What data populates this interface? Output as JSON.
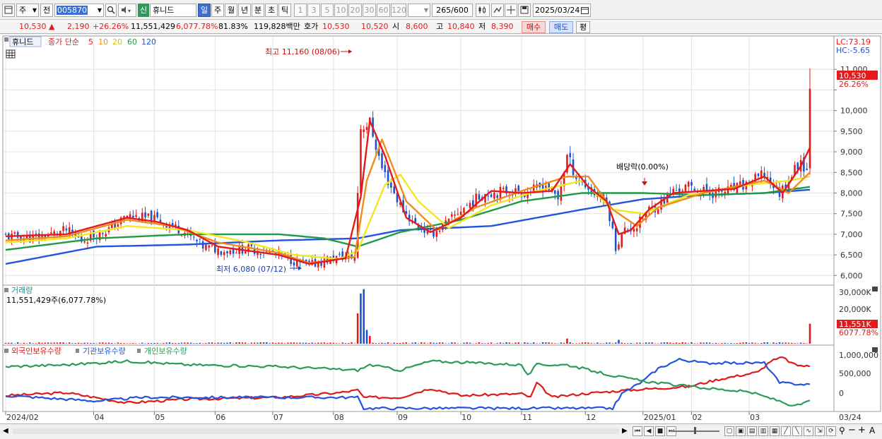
{
  "toolbar": {
    "market_type": "주",
    "prev_label": "전",
    "stock_code": "005870",
    "new_badge": "신",
    "stock_name": "휴니드",
    "periods": [
      "일",
      "주",
      "월",
      "년",
      "분",
      "초",
      "틱"
    ],
    "active_period": "일",
    "intervals": [
      "1",
      "3",
      "5",
      "10",
      "20",
      "30",
      "60",
      "120"
    ],
    "count": "265",
    "count_total": "/600",
    "date": "2025/03/24"
  },
  "quote": {
    "price": "10,530",
    "change": "2,190",
    "change_pct": "+26.26%",
    "volume": "11,551,429",
    "volume_pct": "6,077.78%",
    "turnover": "81.83%",
    "amount": "119,828백만",
    "hoga_label": "호가",
    "ask": "10,530",
    "bid": "10,520",
    "open_label": "시",
    "open": "8,600",
    "high_label": "고",
    "high": "10,840",
    "low_label": "저",
    "low": "8,390",
    "buy_label": "매수",
    "sell_label": "매도",
    "eval_label": "평"
  },
  "colors": {
    "up": "#e31b1b",
    "down": "#1e52c8",
    "ma5": "#e31b1b",
    "ma10": "#f08c1e",
    "ma20": "#f5e61e",
    "ma60": "#229944",
    "ma120": "#2255dd",
    "foreign": "#e01a1a",
    "institution": "#2255dd",
    "individual": "#2b9a5a",
    "price_badge": "#e31b1b",
    "toolbar_selected": "#3b6fd1"
  },
  "chart_data": [
    {
      "type": "candlestick",
      "title": "휴니드",
      "legend": {
        "prefix": "종가 단순",
        "items": [
          {
            "name": "5",
            "color": "#e31b1b"
          },
          {
            "name": "10",
            "color": "#f08c1e"
          },
          {
            "name": "20",
            "color": "#d8c400"
          },
          {
            "name": "60",
            "color": "#229944"
          },
          {
            "name": "120",
            "color": "#2255dd"
          }
        ]
      },
      "ylim": [
        5800,
        11500
      ],
      "y_ticks": [
        6000,
        6500,
        7000,
        7500,
        8000,
        8500,
        9000,
        9500,
        10000,
        10500,
        11000
      ],
      "y_tick_labels": [
        "6,000",
        "6,500",
        "7,000",
        "7,500",
        "8,000",
        "8,500",
        "9,000",
        "9,500",
        "10,000",
        "",
        "11,000"
      ],
      "lc_label": "LC:73.19",
      "hc_label": "HC:-5.65",
      "last_price_label": "10,530",
      "last_pct_label": "26.26%",
      "annotations": {
        "high": "최고 11,160 (08/06)",
        "low": "최저 6,080 (07/12)",
        "dividend": "배당락(0.00%)"
      },
      "x_tick_labels": [
        "2024/02",
        "04",
        "05",
        "06",
        "07",
        "08",
        "09",
        "10",
        "11",
        "12",
        "2025/01",
        "02",
        "03",
        "03/24"
      ],
      "anchors": [
        [
          0,
          6950
        ],
        [
          10,
          6900
        ],
        [
          20,
          7100
        ],
        [
          25,
          6850
        ],
        [
          35,
          7150
        ],
        [
          40,
          7450
        ],
        [
          50,
          7350
        ],
        [
          58,
          7100
        ],
        [
          65,
          6700
        ],
        [
          72,
          6600
        ],
        [
          80,
          6650
        ],
        [
          88,
          6550
        ],
        [
          95,
          6350
        ],
        [
          100,
          6250
        ],
        [
          110,
          6450
        ],
        [
          115,
          6450
        ],
        [
          117,
          9600
        ],
        [
          120,
          9700
        ],
        [
          124,
          8600
        ],
        [
          130,
          7700
        ],
        [
          134,
          7300
        ],
        [
          140,
          7000
        ],
        [
          146,
          7300
        ],
        [
          150,
          7600
        ],
        [
          158,
          8000
        ],
        [
          166,
          8050
        ],
        [
          172,
          8000
        ],
        [
          178,
          8200
        ],
        [
          182,
          7850
        ],
        [
          185,
          8900
        ],
        [
          188,
          8400
        ],
        [
          193,
          8050
        ],
        [
          198,
          7800
        ],
        [
          201,
          6700
        ],
        [
          204,
          7100
        ],
        [
          208,
          7200
        ],
        [
          212,
          7600
        ],
        [
          215,
          7700
        ],
        [
          220,
          8050
        ],
        [
          225,
          8150
        ],
        [
          232,
          8000
        ],
        [
          238,
          8050
        ],
        [
          244,
          8200
        ],
        [
          250,
          8450
        ],
        [
          255,
          8000
        ],
        [
          262,
          8800
        ],
        [
          264,
          8550
        ],
        [
          265,
          10530
        ]
      ],
      "ma5": [
        [
          0,
          6950
        ],
        [
          20,
          7000
        ],
        [
          40,
          7400
        ],
        [
          50,
          7300
        ],
        [
          60,
          7100
        ],
        [
          70,
          6700
        ],
        [
          90,
          6500
        ],
        [
          100,
          6280
        ],
        [
          112,
          6420
        ],
        [
          117,
          7900
        ],
        [
          120,
          9750
        ],
        [
          125,
          8900
        ],
        [
          132,
          7400
        ],
        [
          140,
          7050
        ],
        [
          150,
          7400
        ],
        [
          160,
          8050
        ],
        [
          170,
          8000
        ],
        [
          180,
          8050
        ],
        [
          186,
          8700
        ],
        [
          192,
          8150
        ],
        [
          198,
          7800
        ],
        [
          202,
          7000
        ],
        [
          206,
          7100
        ],
        [
          212,
          7600
        ],
        [
          220,
          8000
        ],
        [
          230,
          8050
        ],
        [
          240,
          8100
        ],
        [
          250,
          8400
        ],
        [
          256,
          8000
        ],
        [
          262,
          8650
        ],
        [
          265,
          9100
        ]
      ],
      "ma10": [
        [
          0,
          6850
        ],
        [
          20,
          6950
        ],
        [
          40,
          7350
        ],
        [
          55,
          7200
        ],
        [
          70,
          6800
        ],
        [
          90,
          6550
        ],
        [
          100,
          6300
        ],
        [
          115,
          6450
        ],
        [
          119,
          8300
        ],
        [
          124,
          9300
        ],
        [
          132,
          7800
        ],
        [
          142,
          7100
        ],
        [
          155,
          7650
        ],
        [
          170,
          8050
        ],
        [
          185,
          8400
        ],
        [
          192,
          8400
        ],
        [
          200,
          7600
        ],
        [
          208,
          7200
        ],
        [
          215,
          7650
        ],
        [
          230,
          8000
        ],
        [
          250,
          8300
        ],
        [
          258,
          8000
        ],
        [
          265,
          8500
        ]
      ],
      "ma20": [
        [
          0,
          6800
        ],
        [
          20,
          6900
        ],
        [
          40,
          7200
        ],
        [
          60,
          7100
        ],
        [
          80,
          6800
        ],
        [
          95,
          6500
        ],
        [
          110,
          6400
        ],
        [
          116,
          6600
        ],
        [
          125,
          8200
        ],
        [
          130,
          8450
        ],
        [
          136,
          7800
        ],
        [
          146,
          7150
        ],
        [
          160,
          7700
        ],
        [
          175,
          8050
        ],
        [
          190,
          8300
        ],
        [
          200,
          7600
        ],
        [
          210,
          7500
        ],
        [
          225,
          7950
        ],
        [
          245,
          8200
        ],
        [
          258,
          8300
        ],
        [
          265,
          8400
        ]
      ],
      "ma60": [
        [
          0,
          6620
        ],
        [
          30,
          6900
        ],
        [
          60,
          7000
        ],
        [
          90,
          7000
        ],
        [
          105,
          6900
        ],
        [
          116,
          6700
        ],
        [
          130,
          7050
        ],
        [
          150,
          7350
        ],
        [
          170,
          7800
        ],
        [
          190,
          8000
        ],
        [
          210,
          8000
        ],
        [
          230,
          7950
        ],
        [
          250,
          8000
        ],
        [
          265,
          8150
        ]
      ],
      "ma120": [
        [
          0,
          6280
        ],
        [
          30,
          6700
        ],
        [
          60,
          6750
        ],
        [
          90,
          6850
        ],
        [
          116,
          6900
        ],
        [
          130,
          7100
        ],
        [
          160,
          7200
        ],
        [
          190,
          7600
        ],
        [
          210,
          7850
        ],
        [
          230,
          7950
        ],
        [
          250,
          8000
        ],
        [
          265,
          8080
        ]
      ],
      "hidden_panel": true
    },
    {
      "type": "bar",
      "title": "거래량",
      "subtitle": "11,551,429주(6,077.78%)",
      "y_tick_labels": [
        "30,000K",
        "20,000K"
      ],
      "last_label": "11,551K",
      "last_pct_label": "6077.78%",
      "spikes": [
        [
          116,
          17500
        ],
        [
          117,
          29000
        ],
        [
          118,
          31500
        ],
        [
          119,
          8000
        ],
        [
          120,
          4500
        ],
        [
          185,
          3000
        ],
        [
          202,
          2200
        ],
        [
          265,
          11551
        ]
      ]
    },
    {
      "type": "line",
      "title": "외국인보유수량 · 기관보유수량 · 개인보유수량",
      "series": [
        {
          "name": "외국인보유수량",
          "color": "#e01a1a",
          "values": [
            [
              0,
              -50000
            ],
            [
              20,
              30000
            ],
            [
              40,
              -250000
            ],
            [
              60,
              -150000
            ],
            [
              90,
              -100000
            ],
            [
              110,
              30000
            ],
            [
              116,
              100000
            ],
            [
              118,
              -100000
            ],
            [
              130,
              -100000
            ],
            [
              140,
              150000
            ],
            [
              150,
              -50000
            ],
            [
              170,
              0
            ],
            [
              173,
              -100000
            ],
            [
              175,
              300000
            ],
            [
              180,
              -100000
            ],
            [
              190,
              0
            ],
            [
              205,
              100000
            ],
            [
              215,
              150000
            ],
            [
              225,
              200000
            ],
            [
              235,
              400000
            ],
            [
              248,
              600000
            ],
            [
              252,
              900000
            ],
            [
              256,
              1000000
            ],
            [
              260,
              800000
            ],
            [
              265,
              750000
            ]
          ]
        },
        {
          "name": "기관보유수량",
          "color": "#2255dd",
          "values": [
            [
              0,
              -50000
            ],
            [
              30,
              -200000
            ],
            [
              45,
              -100000
            ],
            [
              90,
              -100000
            ],
            [
              116,
              -100000
            ],
            [
              118,
              -400000
            ],
            [
              190,
              -400000
            ],
            [
              200,
              -400000
            ],
            [
              203,
              0
            ],
            [
              210,
              350000
            ],
            [
              215,
              700000
            ],
            [
              222,
              950000
            ],
            [
              230,
              850000
            ],
            [
              250,
              850000
            ],
            [
              255,
              300000
            ],
            [
              265,
              250000
            ]
          ]
        },
        {
          "name": "개인보유수량",
          "color": "#2b9a5a",
          "values": [
            [
              0,
              750000
            ],
            [
              20,
              800000
            ],
            [
              40,
              900000
            ],
            [
              60,
              800000
            ],
            [
              90,
              750000
            ],
            [
              116,
              650000
            ],
            [
              120,
              800000
            ],
            [
              130,
              650000
            ],
            [
              140,
              900000
            ],
            [
              155,
              850000
            ],
            [
              170,
              800000
            ],
            [
              172,
              500000
            ],
            [
              175,
              800000
            ],
            [
              185,
              800000
            ],
            [
              200,
              500000
            ],
            [
              210,
              350000
            ],
            [
              225,
              200000
            ],
            [
              245,
              50000
            ],
            [
              255,
              -200000
            ],
            [
              260,
              -350000
            ],
            [
              265,
              -200000
            ]
          ]
        }
      ],
      "y_tick_labels": [
        "1,000,000",
        "500,000",
        "0"
      ]
    }
  ]
}
